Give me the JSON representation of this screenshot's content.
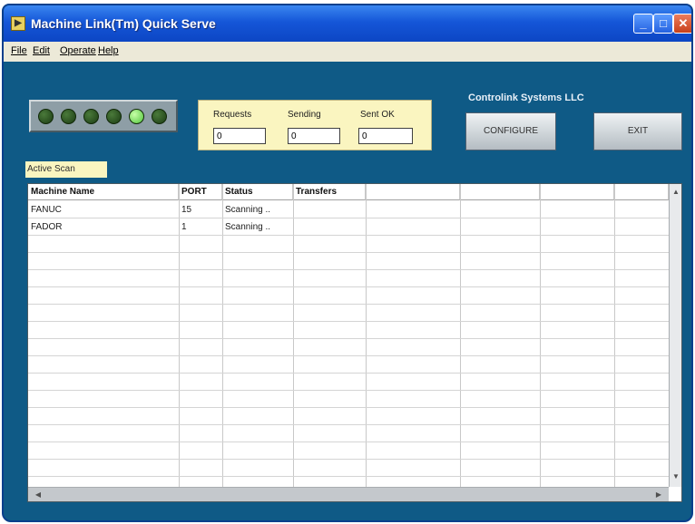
{
  "window": {
    "title": "Machine Link(Tm) Quick Serve",
    "controls": {
      "minimize": "_",
      "maximize": "□",
      "close": "✕"
    }
  },
  "menu": {
    "items": [
      "File",
      "Edit",
      "Operate",
      "Help"
    ]
  },
  "status_leds": {
    "count": 6,
    "active_index": 4,
    "on_color": "#4ec43a",
    "off_color": "#1c3c14"
  },
  "counters": {
    "requests_label": "Requests",
    "requests_value": "0",
    "sending_label": "Sending",
    "sending_value": "0",
    "sent_ok_label": "Sent OK",
    "sent_ok_value": "0"
  },
  "company": "Controlink Systems LLC",
  "buttons": {
    "configure": "CONFIGURE",
    "exit": "EXIT"
  },
  "scan": {
    "label": "Active Scan",
    "columns": [
      "Machine Name",
      "PORT",
      "Status",
      "Transfers",
      "",
      "",
      "",
      ""
    ],
    "rows": [
      [
        "FANUC",
        "15",
        "Scanning ..",
        ""
      ],
      [
        "FADOR",
        "1",
        "Scanning ..",
        ""
      ]
    ]
  },
  "colors": {
    "window_background": "#0f5a86",
    "panel_yellow": "#faf5c0",
    "title_blue": "#1556d8"
  }
}
